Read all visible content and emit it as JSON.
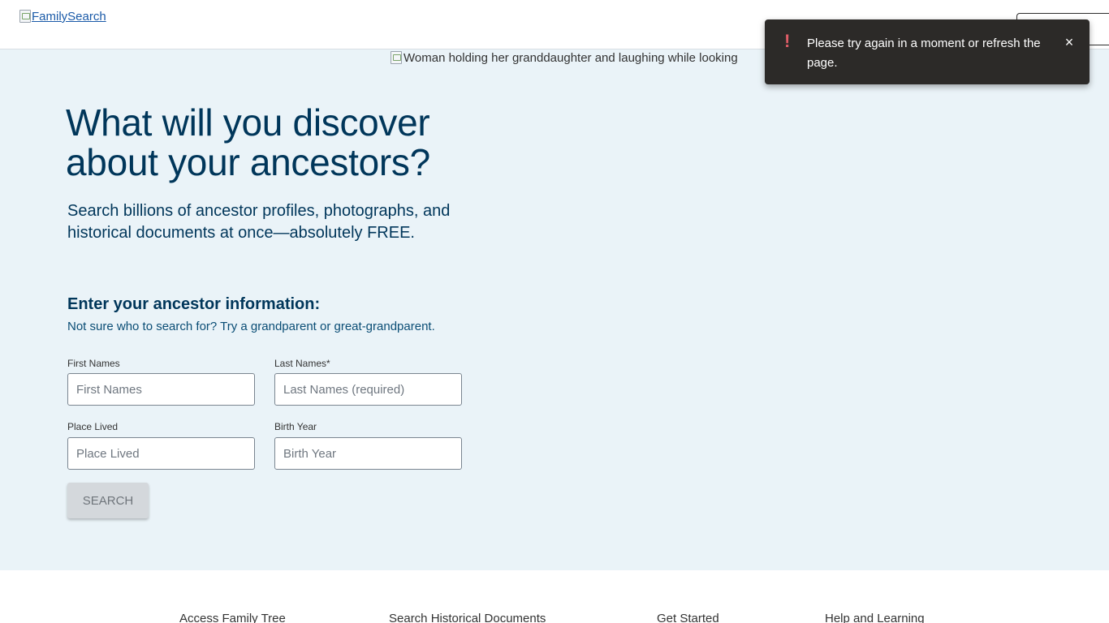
{
  "header": {
    "logo_alt": "FamilySearch"
  },
  "hero": {
    "image_alt": "Woman holding her granddaughter and laughing while looking",
    "headline": "What will you discover about your ancestors?",
    "subhead": "Search billions of ancestor profiles, photographs, and historical documents at once—absolutely FREE."
  },
  "form": {
    "title": "Enter your ancestor information:",
    "hint": "Not sure who to search for? Try a grandparent or great-grandparent.",
    "first_names": {
      "label": "First Names",
      "placeholder": "First Names",
      "value": ""
    },
    "last_names": {
      "label": "Last Names*",
      "placeholder": "Last Names (required)",
      "value": ""
    },
    "place_lived": {
      "label": "Place Lived",
      "placeholder": "Place Lived",
      "value": ""
    },
    "birth_year": {
      "label": "Birth Year",
      "placeholder": "Birth Year",
      "value": ""
    },
    "search_label": "SEARCH"
  },
  "footer_nav": {
    "items": [
      {
        "label": "Access Family Tree"
      },
      {
        "label": "Search Historical Documents"
      },
      {
        "label": "Get Started"
      },
      {
        "label": "Help and Learning"
      }
    ]
  },
  "toast": {
    "icon": "!",
    "message": "Please try again in a moment or refresh the page.",
    "close_icon": "×"
  },
  "colors": {
    "hero_bg": "#eaf3f8",
    "brand_text": "#00365a",
    "toast_bg": "#2c2a28",
    "toast_icon": "#e05d67",
    "button_disabled_bg": "#d4d8dc"
  }
}
